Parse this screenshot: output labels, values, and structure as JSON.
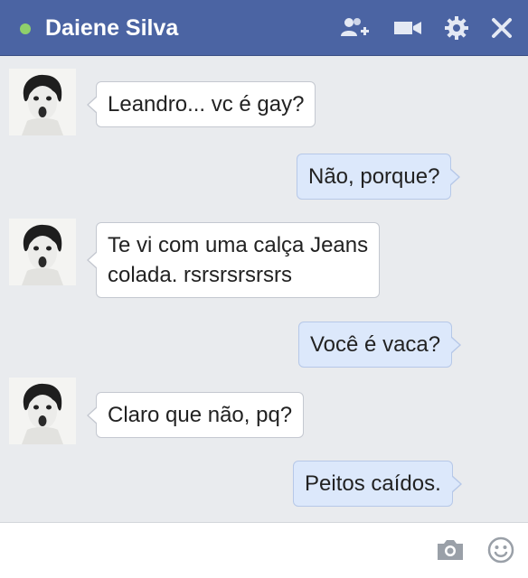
{
  "header": {
    "contact_name": "Daiene Silva",
    "status": "online",
    "status_color": "#8fd06b",
    "bar_color": "#4b64a3",
    "icons": [
      "add-friend-icon",
      "video-call-icon",
      "gear-icon",
      "close-icon"
    ]
  },
  "messages": [
    {
      "direction": "in",
      "text": "Leandro... vc é gay?"
    },
    {
      "direction": "out",
      "text": "Não, porque?"
    },
    {
      "direction": "in",
      "lines": [
        "Te vi com uma calça Jeans",
        "colada. rsrsrsrsrsrs"
      ]
    },
    {
      "direction": "out",
      "text": "Você é vaca?"
    },
    {
      "direction": "in",
      "text": "Claro que não, pq?"
    },
    {
      "direction": "out",
      "text": "Peitos caídos."
    }
  ],
  "composer": {
    "placeholder": "",
    "icons": [
      "camera-icon",
      "emoji-icon"
    ]
  }
}
